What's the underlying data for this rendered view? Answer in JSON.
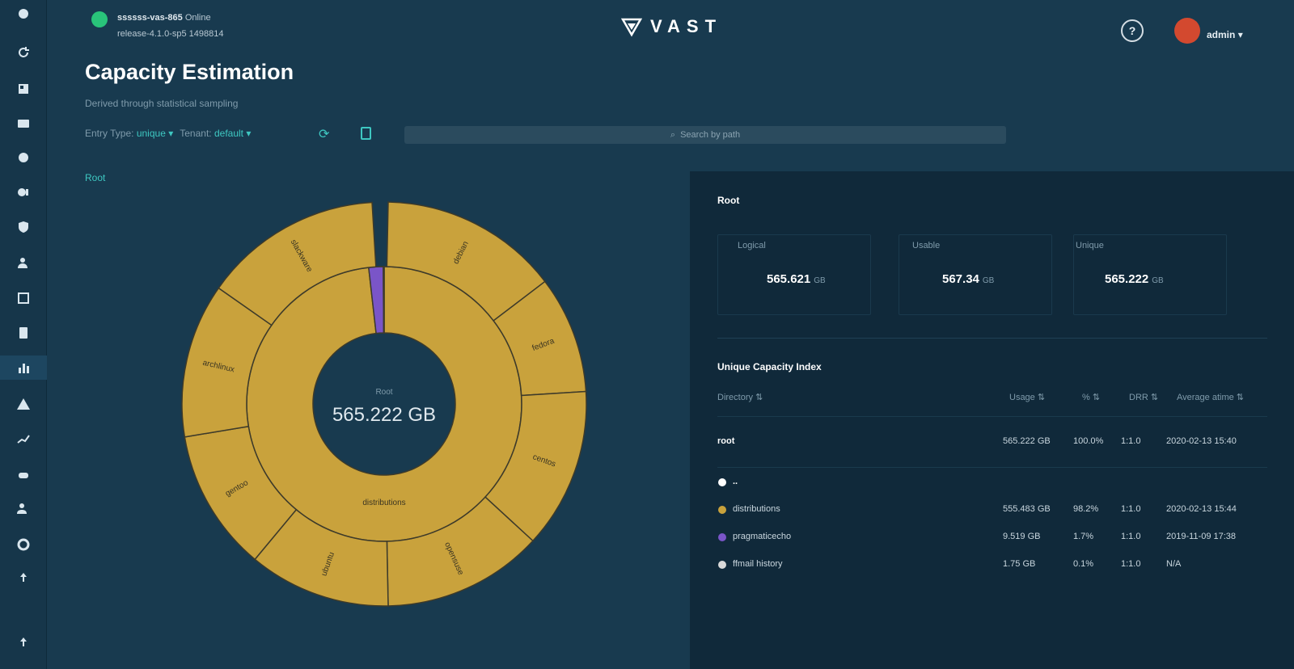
{
  "header": {
    "cluster_name": "ssssss-vas-865",
    "cluster_status": "Online",
    "cluster_version": "release-4.1.0-sp5 1498814",
    "logo_text": "VAST",
    "username": "admin",
    "user_menu_icon": "chevron-down-icon"
  },
  "page": {
    "title": "Capacity Estimation",
    "subtitle": "Derived through statistical sampling",
    "filter_type_label": "Entry Type:",
    "filter_type_value": "unique",
    "filter_tenant_label": "Tenant:",
    "filter_tenant_value": "default",
    "search_placeholder": "Search by path",
    "breadcrumb": "Root"
  },
  "chart_data": {
    "type": "sunburst",
    "center_label": "Root",
    "center_value": "565.222 GB",
    "inner_ring": [
      {
        "name": "distributions",
        "percent": 98.2,
        "color": "#c9a23c"
      },
      {
        "name": "pragmaticecho",
        "percent": 1.7,
        "color": "#7a55c8"
      },
      {
        "name": "ffmail history",
        "percent": 0.1,
        "color": "#c9a23c"
      }
    ],
    "outer_ring": [
      {
        "name": "debian"
      },
      {
        "name": "fedora"
      },
      {
        "name": "centos"
      },
      {
        "name": "opensuse"
      },
      {
        "name": "ubuntu"
      },
      {
        "name": "gentoo"
      },
      {
        "name": "archlinux"
      },
      {
        "name": "slackware"
      }
    ]
  },
  "panel": {
    "title": "Root",
    "stats": [
      {
        "label": "Logical",
        "value": "565.621",
        "unit": "GB"
      },
      {
        "label": "Usable",
        "value": "567.34",
        "unit": "GB"
      },
      {
        "label": "Unique",
        "value": "565.222",
        "unit": "GB"
      }
    ],
    "table_title": "Unique Capacity Index",
    "columns": [
      "Directory",
      "Usage",
      "%",
      "DRR",
      "Average atime"
    ],
    "root_row": {
      "name": "root",
      "usage": "565.222 GB",
      "pct": "100.0%",
      "drr": "1:1.0",
      "atime": "2020-02-13 15:40"
    },
    "rows": [
      {
        "name": "..",
        "usage": "",
        "pct": "",
        "drr": "",
        "atime": "",
        "color": "#ffffff"
      },
      {
        "name": "distributions",
        "usage": "555.483 GB",
        "pct": "98.2%",
        "drr": "1:1.0",
        "atime": "2020-02-13 15:44",
        "color": "#c9a23c"
      },
      {
        "name": "pragmaticecho",
        "usage": "9.519 GB",
        "pct": "1.7%",
        "drr": "1:1.0",
        "atime": "2019-11-09 17:38",
        "color": "#7a55c8"
      },
      {
        "name": "ffmail history",
        "usage": "1.75 GB",
        "pct": "0.1%",
        "drr": "1:1.0",
        "atime": "N/A",
        "color": "#d9d9d9"
      }
    ]
  },
  "colors": {
    "background": "#183a4f",
    "panel": "#10293a",
    "accent": "#3ec7c1",
    "gold": "#c9a23c",
    "purple": "#7a55c8"
  }
}
